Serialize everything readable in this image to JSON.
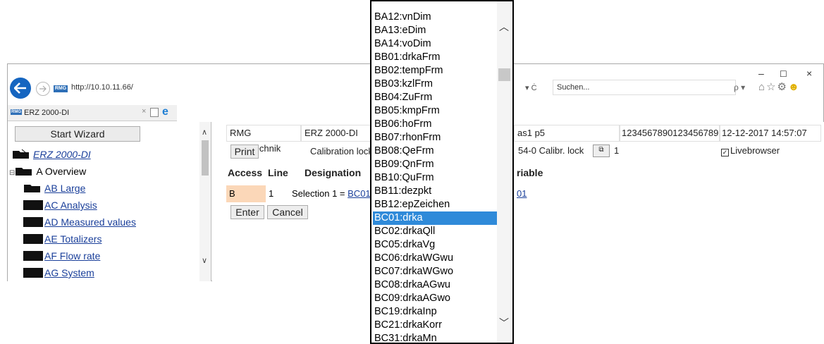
{
  "browser": {
    "url": "http://10.10.11.66/",
    "url_controls": "▾ Ċ",
    "search_placeholder": "Suchen...",
    "search_controls": "ρ ▾",
    "tab_title": "ERZ 2000-DI",
    "tab_close": "×",
    "favicon_text": "RMG",
    "window_controls": {
      "minimize": "–",
      "maximize": "☐",
      "close": "×"
    }
  },
  "sidebar": {
    "wizard_button": "Start Wizard",
    "root": "ERZ 2000-DI",
    "overview": "A Overview",
    "items": [
      {
        "label": "AB Large"
      },
      {
        "label": "AC Analysis"
      },
      {
        "label": "AD Measured values"
      },
      {
        "label": "AE Totalizers"
      },
      {
        "label": "AF Flow rate"
      },
      {
        "label": "AG System"
      }
    ]
  },
  "main": {
    "info_row": {
      "company": "RMG Messtechnik",
      "device": "ERZ 2000-DI",
      "param": "as1 p5",
      "serial": "1234567890123456789",
      "datetime": "12-12-2017 14:57:07"
    },
    "control_row": {
      "print_label": "Print",
      "calibration_lock": "Calibration lock",
      "calibr_text": "54-0 Calibr. lock",
      "lock_value": "1",
      "livebrowser": "Livebrowser"
    },
    "table_headers": {
      "access": "Access",
      "line": "Line",
      "designation": "Designation",
      "variable": "riable"
    },
    "table_row": {
      "access": "B",
      "line": "1",
      "designation_prefix": "Selection 1 = ",
      "designation_link": "BC01",
      "variable_link": "01"
    },
    "enter_label": "Enter",
    "cancel_label": "Cancel"
  },
  "dropdown": {
    "options": [
      "BA12:vnDim",
      "BA13:eDim",
      "BA14:voDim",
      "BB01:drkaFrm",
      "BB02:tempFrm",
      "BB03:kzlFrm",
      "BB04:ZuFrm",
      "BB05:kmpFrm",
      "BB06:hoFrm",
      "BB07:rhonFrm",
      "BB08:QeFrm",
      "BB09:QnFrm",
      "BB10:QuFrm",
      "BB11:dezpkt",
      "BB12:epZeichen",
      "BC01:drka",
      "BC02:drkaQll",
      "BC05:drkaVg",
      "BC06:drkaWGwu",
      "BC07:drkaWGwo",
      "BC08:drkaAGwu",
      "BC09:drkaAGwo",
      "BC19:drkaInp",
      "BC21:drkaKorr",
      "BC31:drkaMn"
    ],
    "selected": "BC01:drka"
  }
}
